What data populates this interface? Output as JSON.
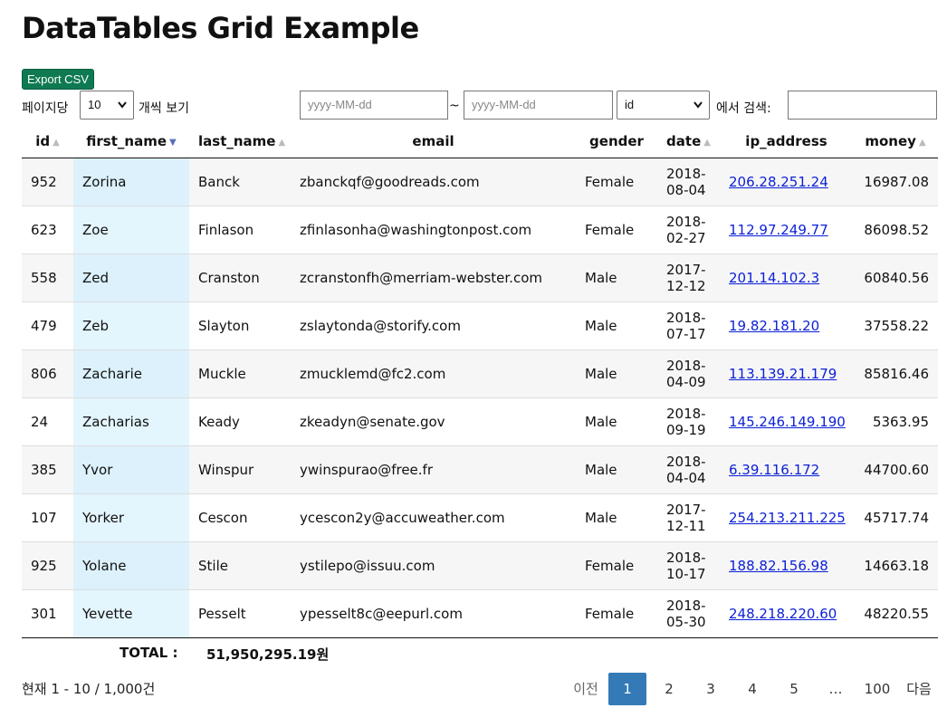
{
  "title": "DataTables Grid Example",
  "export_label": "Export CSV",
  "toolbar": {
    "per_page_label": "페이지당",
    "per_page_value": "10",
    "per_page_suffix": "개씩 보기",
    "date_from_placeholder": "yyyy-MM-dd",
    "date_sep": "~",
    "date_to_placeholder": "yyyy-MM-dd",
    "search_field_value": "id",
    "search_label": "에서 검색:",
    "search_value": ""
  },
  "columns": [
    {
      "label": "id",
      "sort": "both"
    },
    {
      "label": "first_name",
      "sort": "desc"
    },
    {
      "label": "last_name",
      "sort": "both"
    },
    {
      "label": "email",
      "sort": "none"
    },
    {
      "label": "gender",
      "sort": "none"
    },
    {
      "label": "date",
      "sort": "both"
    },
    {
      "label": "ip_address",
      "sort": "none"
    },
    {
      "label": "money",
      "sort": "both"
    }
  ],
  "rows": [
    {
      "id": "952",
      "first_name": "Zorina",
      "last_name": "Banck",
      "email": "zbanckqf@goodreads.com",
      "gender": "Female",
      "date": "2018-08-04",
      "ip_address": "206.28.251.24",
      "money": "16987.08"
    },
    {
      "id": "623",
      "first_name": "Zoe",
      "last_name": "Finlason",
      "email": "zfinlasonha@washingtonpost.com",
      "gender": "Female",
      "date": "2018-02-27",
      "ip_address": "112.97.249.77",
      "money": "86098.52"
    },
    {
      "id": "558",
      "first_name": "Zed",
      "last_name": "Cranston",
      "email": "zcranstonfh@merriam-webster.com",
      "gender": "Male",
      "date": "2017-12-12",
      "ip_address": "201.14.102.3",
      "money": "60840.56"
    },
    {
      "id": "479",
      "first_name": "Zeb",
      "last_name": "Slayton",
      "email": "zslaytonda@storify.com",
      "gender": "Male",
      "date": "2018-07-17",
      "ip_address": "19.82.181.20",
      "money": "37558.22"
    },
    {
      "id": "806",
      "first_name": "Zacharie",
      "last_name": "Muckle",
      "email": "zmucklemd@fc2.com",
      "gender": "Male",
      "date": "2018-04-09",
      "ip_address": "113.139.21.179",
      "money": "85816.46"
    },
    {
      "id": "24",
      "first_name": "Zacharias",
      "last_name": "Keady",
      "email": "zkeadyn@senate.gov",
      "gender": "Male",
      "date": "2018-09-19",
      "ip_address": "145.246.149.190",
      "money": "5363.95"
    },
    {
      "id": "385",
      "first_name": "Yvor",
      "last_name": "Winspur",
      "email": "ywinspurao@free.fr",
      "gender": "Male",
      "date": "2018-04-04",
      "ip_address": "6.39.116.172",
      "money": "44700.60"
    },
    {
      "id": "107",
      "first_name": "Yorker",
      "last_name": "Cescon",
      "email": "ycescon2y@accuweather.com",
      "gender": "Male",
      "date": "2017-12-11",
      "ip_address": "254.213.211.225",
      "money": "45717.74"
    },
    {
      "id": "925",
      "first_name": "Yolane",
      "last_name": "Stile",
      "email": "ystilepo@issuu.com",
      "gender": "Female",
      "date": "2018-10-17",
      "ip_address": "188.82.156.98",
      "money": "14663.18"
    },
    {
      "id": "301",
      "first_name": "Yevette",
      "last_name": "Pesselt",
      "email": "ypesselt8c@eepurl.com",
      "gender": "Female",
      "date": "2018-05-30",
      "ip_address": "248.218.220.60",
      "money": "48220.55"
    }
  ],
  "total": {
    "label": "TOTAL :",
    "value": "51,950,295.19원"
  },
  "info": "현재 1 - 10 / 1,000건",
  "pagination": {
    "prev": "이전",
    "pages": [
      "1",
      "2",
      "3",
      "4",
      "5",
      "…",
      "100"
    ],
    "active": "1",
    "next": "다음"
  },
  "colors": {
    "sorted_column": "#dcf1fb",
    "link": "#0b1fd6",
    "export_button": "#0f7a52",
    "active_page": "#337ab7"
  }
}
